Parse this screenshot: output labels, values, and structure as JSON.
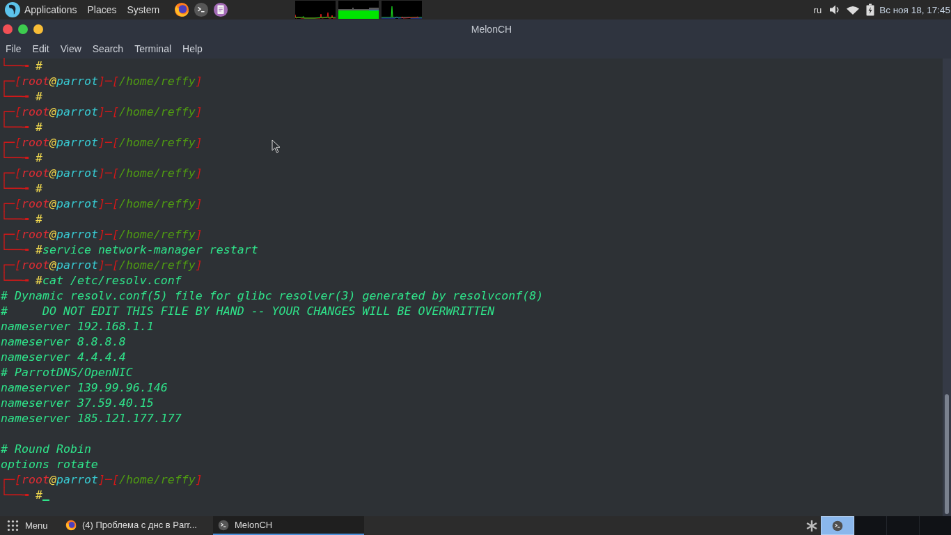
{
  "top_panel": {
    "menus": [
      "Applications",
      "Places",
      "System"
    ],
    "keyboard_layout": "ru",
    "clock": "Вс ноя 18, 17:45"
  },
  "window": {
    "title": "MelonCH",
    "menu": [
      "File",
      "Edit",
      "View",
      "Search",
      "Terminal",
      "Help"
    ]
  },
  "terminal": {
    "lines": [
      {
        "kind": "prompt_input",
        "corner": "└──╼",
        "sign": "#",
        "cursor": false
      },
      {
        "kind": "prompt_head",
        "corner": "┌─",
        "open": "[",
        "user": "root",
        "at": "@",
        "host": "parrot",
        "separator": "]─[",
        "path": "/home/reffy",
        "close": "]"
      },
      {
        "kind": "prompt_input",
        "corner": "└──╼",
        "sign": "#",
        "cursor": false
      },
      {
        "kind": "prompt_head",
        "corner": "┌─",
        "open": "[",
        "user": "root",
        "at": "@",
        "host": "parrot",
        "separator": "]─[",
        "path": "/home/reffy",
        "close": "]"
      },
      {
        "kind": "prompt_input",
        "corner": "└──╼",
        "sign": "#",
        "cursor": false
      },
      {
        "kind": "prompt_head",
        "corner": "┌─",
        "open": "[",
        "user": "root",
        "at": "@",
        "host": "parrot",
        "separator": "]─[",
        "path": "/home/reffy",
        "close": "]"
      },
      {
        "kind": "prompt_input",
        "corner": "└──╼",
        "sign": "#",
        "cursor": false
      },
      {
        "kind": "prompt_head",
        "corner": "┌─",
        "open": "[",
        "user": "root",
        "at": "@",
        "host": "parrot",
        "separator": "]─[",
        "path": "/home/reffy",
        "close": "]"
      },
      {
        "kind": "prompt_input",
        "corner": "└──╼",
        "sign": "#",
        "cursor": false
      },
      {
        "kind": "prompt_head",
        "corner": "┌─",
        "open": "[",
        "user": "root",
        "at": "@",
        "host": "parrot",
        "separator": "]─[",
        "path": "/home/reffy",
        "close": "]"
      },
      {
        "kind": "prompt_input",
        "corner": "└──╼",
        "sign": "#",
        "cursor": false
      },
      {
        "kind": "prompt_head",
        "corner": "┌─",
        "open": "[",
        "user": "root",
        "at": "@",
        "host": "parrot",
        "separator": "]─[",
        "path": "/home/reffy",
        "close": "]"
      },
      {
        "kind": "prompt_input",
        "corner": "└──╼",
        "sign": "#",
        "command": "service network-manager restart",
        "cursor": false
      },
      {
        "kind": "prompt_head",
        "corner": "┌─",
        "open": "[",
        "user": "root",
        "at": "@",
        "host": "parrot",
        "separator": "]─[",
        "path": "/home/reffy",
        "close": "]"
      },
      {
        "kind": "prompt_input",
        "corner": "└──╼",
        "sign": "#",
        "command": "cat /etc/resolv.conf",
        "cursor": false
      },
      {
        "kind": "output",
        "text": "# Dynamic resolv.conf(5) file for glibc resolver(3) generated by resolvconf(8)"
      },
      {
        "kind": "output",
        "text": "#     DO NOT EDIT THIS FILE BY HAND -- YOUR CHANGES WILL BE OVERWRITTEN"
      },
      {
        "kind": "output",
        "text": "nameserver 192.168.1.1"
      },
      {
        "kind": "output",
        "text": "nameserver 8.8.8.8"
      },
      {
        "kind": "output",
        "text": "nameserver 4.4.4.4"
      },
      {
        "kind": "output",
        "text": "# ParrotDNS/OpenNIC"
      },
      {
        "kind": "output",
        "text": "nameserver 139.99.96.146"
      },
      {
        "kind": "output",
        "text": "nameserver 37.59.40.15"
      },
      {
        "kind": "output",
        "text": "nameserver 185.121.177.177"
      },
      {
        "kind": "blank"
      },
      {
        "kind": "output",
        "text": "# Round Robin"
      },
      {
        "kind": "output",
        "text": "options rotate"
      },
      {
        "kind": "prompt_head",
        "corner": "┌─",
        "open": "[",
        "user": "root",
        "at": "@",
        "host": "parrot",
        "separator": "]─[",
        "path": "/home/reffy",
        "close": "]"
      },
      {
        "kind": "prompt_input",
        "corner": "└──╼",
        "sign": "#",
        "cursor": true
      }
    ]
  },
  "taskbar": {
    "menu_label": "Menu",
    "tasks": [
      {
        "kind": "browser",
        "label": "(4) Проблема с днс в Parr...",
        "selected": false
      },
      {
        "kind": "terminal",
        "label": "MelonCH",
        "selected": true
      }
    ],
    "workspaces": [
      {
        "kind": "terminal",
        "selected": true
      },
      {
        "kind": "empty",
        "selected": false
      },
      {
        "kind": "empty",
        "selected": false
      },
      {
        "kind": "empty",
        "selected": false
      }
    ]
  }
}
